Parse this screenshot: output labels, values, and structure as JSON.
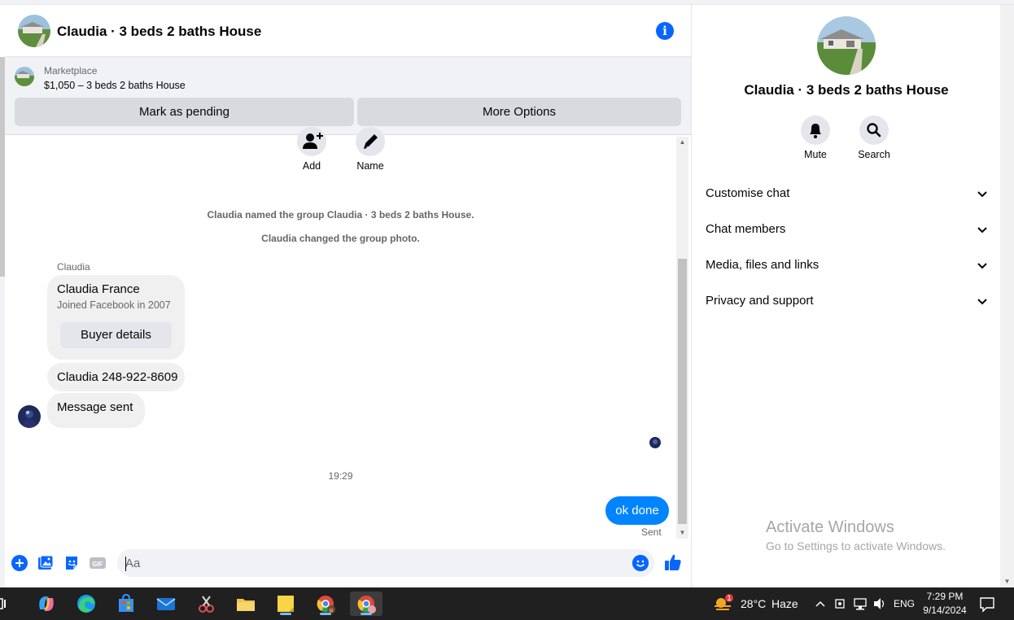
{
  "chat": {
    "title": "Claudia · 3 beds 2 baths House"
  },
  "marketplace": {
    "label": "Marketplace",
    "listing": "$1,050 – 3 beds 2 baths House",
    "pending_button": "Mark as pending",
    "more_button": "More Options"
  },
  "actions": [
    {
      "label": "Add",
      "icon": "add-person-icon"
    },
    {
      "label": "Name",
      "icon": "pencil-icon"
    }
  ],
  "messages": {
    "system_1": "Claudia named the group Claudia · 3 beds 2 baths House.",
    "system_2": "Claudia changed the group photo.",
    "sender": "Claudia",
    "card_name": "Claudia France",
    "card_sub": "Joined Facebook in 2007",
    "card_button": "Buyer details",
    "incoming_1": "Claudia 248-922-8609",
    "incoming_2": "Message sent",
    "timestamp": "19:29",
    "outgoing": "ok done",
    "status": "Sent"
  },
  "composer": {
    "placeholder": "Aa",
    "icons": [
      "plus-icon",
      "photo-icon",
      "sticker-icon",
      "gif-icon",
      "emoji-icon",
      "thumbs-up-icon"
    ]
  },
  "right_panel": {
    "title": "Claudia · 3 beds 2 baths House",
    "mute_label": "Mute",
    "search_label": "Search",
    "sections": [
      "Customise chat",
      "Chat members",
      "Media, files and links",
      "Privacy and support"
    ]
  },
  "watermark": {
    "line1": "Activate Windows",
    "line2": "Go to Settings to activate Windows."
  },
  "taskbar": {
    "weather_temp": "28°C",
    "weather_desc": "Haze",
    "weather_badge": "1",
    "language": "ENG",
    "time": "7:29 PM",
    "date": "9/14/2024"
  },
  "colors": {
    "accent": "#0866ff",
    "outgoing_bubble": "#0084ff",
    "bubble_in": "#f0f0f0",
    "taskbar": "#202020"
  }
}
